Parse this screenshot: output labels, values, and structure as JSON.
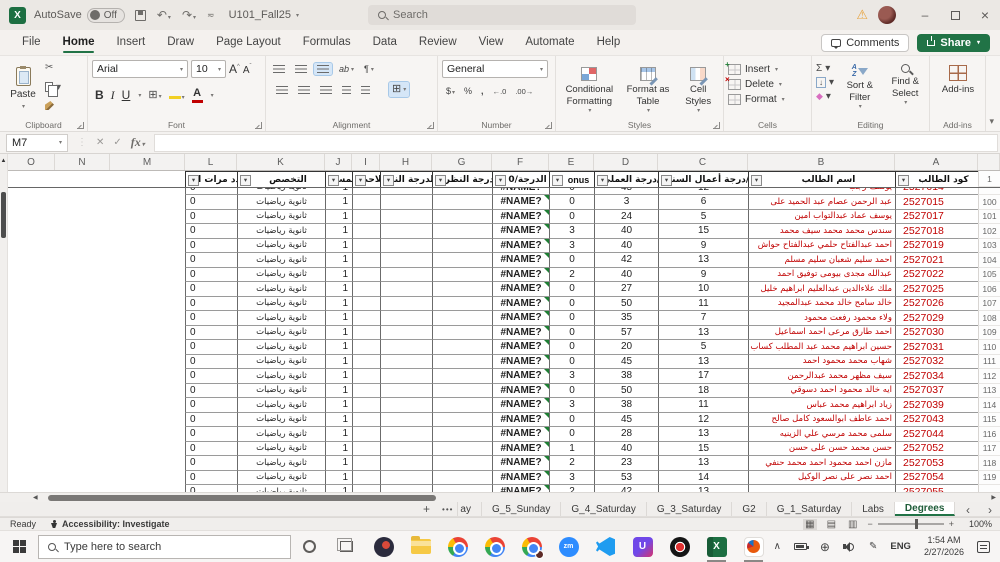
{
  "window": {
    "autosave_label": "AutoSave",
    "autosave_state": "Off",
    "filename": "U101_Fall25",
    "search_placeholder": "Search"
  },
  "menu": {
    "tabs": [
      "File",
      "Home",
      "Insert",
      "Draw",
      "Page Layout",
      "Formulas",
      "Data",
      "Review",
      "View",
      "Automate",
      "Help"
    ],
    "active_tab": "Home",
    "comments": "Comments",
    "share": "Share"
  },
  "ribbon": {
    "paste": "Paste",
    "font_name": "Arial",
    "font_size": "10",
    "number_format": "General",
    "conditional_formatting": "Conditional Formatting",
    "format_as_table": "Format as Table",
    "cell_styles": "Cell Styles",
    "insert": "Insert",
    "delete": "Delete",
    "format": "Format",
    "sort_filter": "Sort & Filter",
    "find_select": "Find & Select",
    "add_ins": "Add-ins",
    "group_labels": {
      "clipboard": "Clipboard",
      "font": "Font",
      "alignment": "Alignment",
      "number": "Number",
      "styles": "Styles",
      "cells": "Cells",
      "editing": "Editing",
      "addins": "Add-ins"
    },
    "currency": "$",
    "percent": "%",
    "comma": ",",
    "dec_inc": "←.0",
    "dec_dec": ".00→"
  },
  "formula_bar": {
    "name_box": "M7",
    "formula": ""
  },
  "icons": {
    "dropdown": "▾",
    "undo": "↶",
    "redo": "↷",
    "more": "⌇",
    "warning": "⚠",
    "cut": "✂",
    "sum": "Σ",
    "fill": "↓",
    "clear": "◆",
    "check": "✓",
    "cancel": "✕",
    "close": "×",
    "minimize": "–",
    "fx": "fx",
    "up_arrow": "▲",
    "left_arrow": "◀",
    "right_arrow": "▶",
    "tab_prev": "‹",
    "tab_next": "›",
    "filter": "▾",
    "view_normal": "▦",
    "view_layout": "▤",
    "view_break": "▥",
    "tray_expand": "∧",
    "globe": "⊕",
    "ink": "✎",
    "minus": "−",
    "plus": "+",
    "ellipsis": "•••",
    "new_sheet": "+",
    "bold": "B",
    "italic": "I",
    "underline": "U",
    "border": "⊞",
    "merge": "⊞",
    "font_color_a": "A",
    "grow_a": "A",
    "wrap": "¶",
    "orient": "ab",
    "excel_logo_letter": "X",
    "zoom_badge": "zm",
    "purple_app_letter": "U",
    "insert_badge": "+",
    "delete_badge": "×"
  },
  "sheet": {
    "column_letters": [
      "O",
      "N",
      "M",
      "L",
      "K",
      "J",
      "I",
      "H",
      "G",
      "F",
      "E",
      "D",
      "C",
      "B",
      "A"
    ],
    "headers": {
      "A": "كود الطالب",
      "B": "اسم الطالب",
      "C": "درجة أعمال السنة/(",
      "D": "درجة العملي/(",
      "E": "onus",
      "F": "الدرجة/0",
      "G": "درجة النظري/(",
      "H": "الدرجة النه",
      "I": "ملاحظ",
      "J": "المس",
      "K": "التخصص",
      "L": "عدد مرات الر"
    },
    "header_row_number": "1",
    "common": {
      "grade": "#NAME?",
      "level": "1",
      "major": "ثانوية رياضيات",
      "repeats": "0"
    },
    "partial_top_row": {
      "num": "",
      "code": "2527014",
      "name": "يوسف رجب",
      "year_work": "12",
      "bonus": "0",
      "practical": "45"
    },
    "rows": [
      {
        "num": "100",
        "code": "2527015",
        "name": "عبد الرحمن عصام عبد الحميد على",
        "year_work": "6",
        "bonus": "0",
        "practical": "3"
      },
      {
        "num": "101",
        "code": "2527017",
        "name": "يوسف عماد عبدالتواب امين",
        "year_work": "5",
        "bonus": "0",
        "practical": "24"
      },
      {
        "num": "102",
        "code": "2527018",
        "name": "سندس محمد محمد سيف محمد",
        "year_work": "15",
        "bonus": "3",
        "practical": "40"
      },
      {
        "num": "103",
        "code": "2527019",
        "name": "احمد عبدالفتاح حلمي عبدالفتاح حواش",
        "year_work": "9",
        "bonus": "3",
        "practical": "40"
      },
      {
        "num": "104",
        "code": "2527021",
        "name": "احمد سليم شعبان سليم مسلم",
        "year_work": "13",
        "bonus": "0",
        "practical": "42"
      },
      {
        "num": "105",
        "code": "2527022",
        "name": "عبدالله مجدى بيومى توفيق احمد",
        "year_work": "9",
        "bonus": "2",
        "practical": "40"
      },
      {
        "num": "106",
        "code": "2527025",
        "name": "ملك علاءالدين عبدالعليم ابراهيم خليل",
        "year_work": "10",
        "bonus": "0",
        "practical": "27"
      },
      {
        "num": "107",
        "code": "2527026",
        "name": "خالد سامح خالد محمد عبدالمجيد",
        "year_work": "11",
        "bonus": "0",
        "practical": "50"
      },
      {
        "num": "108",
        "code": "2527029",
        "name": "ولاء محمود رفعت محمود",
        "year_work": "7",
        "bonus": "0",
        "practical": "35"
      },
      {
        "num": "109",
        "code": "2527030",
        "name": "احمد طارق مرعى احمد اسماعيل",
        "year_work": "13",
        "bonus": "0",
        "practical": "57"
      },
      {
        "num": "110",
        "code": "2527031",
        "name": "حسين ابراهيم محمد عبد المطلب كساب",
        "year_work": "5",
        "bonus": "0",
        "practical": "20"
      },
      {
        "num": "111",
        "code": "2527032",
        "name": "شهاب محمد محمود احمد",
        "year_work": "13",
        "bonus": "0",
        "practical": "45"
      },
      {
        "num": "112",
        "code": "2527034",
        "name": "سيف مظهر محمد عبدالرحمن",
        "year_work": "17",
        "bonus": "3",
        "practical": "38"
      },
      {
        "num": "113",
        "code": "2527037",
        "name": "ايه خالد محمود احمد دسوقي",
        "year_work": "18",
        "bonus": "0",
        "practical": "50"
      },
      {
        "num": "114",
        "code": "2527039",
        "name": "زياد ابراهيم محمد عباس",
        "year_work": "11",
        "bonus": "3",
        "practical": "38"
      },
      {
        "num": "115",
        "code": "2527043",
        "name": "احمد عاطف ابوالسعود كامل صالح",
        "year_work": "12",
        "bonus": "0",
        "practical": "45"
      },
      {
        "num": "116",
        "code": "2527044",
        "name": "سلمى محمد مرسي علي الزينيه",
        "year_work": "13",
        "bonus": "0",
        "practical": "28"
      },
      {
        "num": "117",
        "code": "2527052",
        "name": "حسن محمد حسن على حسن",
        "year_work": "15",
        "bonus": "1",
        "practical": "40"
      },
      {
        "num": "118",
        "code": "2527053",
        "name": "مازن احمد محمود احمد محمد حنفي",
        "year_work": "13",
        "bonus": "2",
        "practical": "23"
      },
      {
        "num": "119",
        "code": "2527054",
        "name": "احمد نصر على نصر الوكيل",
        "year_work": "14",
        "bonus": "3",
        "practical": "53"
      }
    ],
    "partial_bottom_row": {
      "num": "",
      "code": "2527055",
      "name": "",
      "year_work": "13",
      "bonus": "2",
      "practical": "42"
    }
  },
  "tabs_bar": {
    "partial_tab": "ay",
    "sheets": [
      "G_5_Sunday",
      "G_4_Saturday",
      "G_3_Saturday",
      "G2",
      "G_1_Saturday",
      "Labs",
      "Degrees"
    ],
    "active_sheet": "Degrees"
  },
  "status_bar": {
    "mode": "Ready",
    "accessibility": "Accessibility: Investigate",
    "zoom_level": "100%"
  },
  "taskbar": {
    "search_placeholder": "Type here to search",
    "language": "ENG",
    "time": "1:54 AM",
    "date": "2/27/2026"
  }
}
